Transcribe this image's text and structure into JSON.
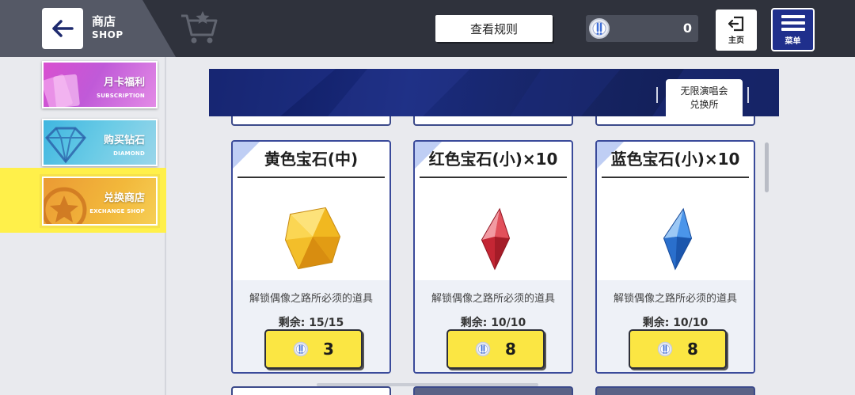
{
  "header": {
    "title_cn": "商店",
    "title_en": "SHOP",
    "rules_label": "查看规则",
    "currency_amount": "0",
    "home_label": "主页",
    "menu_label": "菜单"
  },
  "sidebar": {
    "items": [
      {
        "label_cn": "月卡福利",
        "label_en": "SUBSCRIPTION",
        "active": false
      },
      {
        "label_cn": "购买钻石",
        "label_en": "DIAMOND",
        "active": false
      },
      {
        "label_cn": "兑换商店",
        "label_en": "EXCHANGE SHOP",
        "active": true
      }
    ]
  },
  "banner": {
    "tab_line1": "无限演唱会",
    "tab_line2": "兑换所"
  },
  "items": [
    {
      "name": "黄色宝石(中)",
      "desc": "解锁偶像之路所必须的道具",
      "remain": "剩余: 15/15",
      "price": "3",
      "gem_color": "#f5c52a",
      "gem_icon": "yellow-gem-icon"
    },
    {
      "name": "红色宝石(小)×10",
      "desc": "解锁偶像之路所必须的道具",
      "remain": "剩余: 10/10",
      "price": "8",
      "gem_color": "#d8323e",
      "gem_icon": "red-gem-icon"
    },
    {
      "name": "蓝色宝石(小)×10",
      "desc": "解锁偶像之路所必须的道具",
      "remain": "剩余: 10/10",
      "price": "8",
      "gem_color": "#2f7de0",
      "gem_icon": "blue-gem-icon"
    }
  ],
  "colors": {
    "topbar": "#2f323c",
    "active_tab_highlight": "#fff04a",
    "price_button": "#fbe643",
    "card_border": "#3a4a9a",
    "menu_button": "#1f2f8c"
  }
}
